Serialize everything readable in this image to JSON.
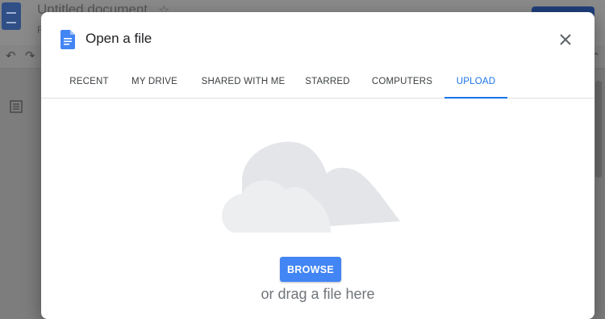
{
  "background": {
    "document_title": "Untitled document",
    "menu_first_letter": "F"
  },
  "dialog": {
    "title": "Open a file",
    "close_icon": "close-icon",
    "tabs": [
      {
        "label": "RECENT",
        "active": false
      },
      {
        "label": "MY DRIVE",
        "active": false
      },
      {
        "label": "SHARED WITH ME",
        "active": false
      },
      {
        "label": "STARRED",
        "active": false
      },
      {
        "label": "COMPUTERS",
        "active": false
      },
      {
        "label": "UPLOAD",
        "active": true
      }
    ],
    "upload": {
      "illustration": "cloud-illustration",
      "browse_label": "BROWSE",
      "drag_text": "or drag a file here"
    }
  },
  "colors": {
    "accent": "#1a73e8",
    "button": "#4285f4",
    "cloud": "#e3e5e8"
  }
}
